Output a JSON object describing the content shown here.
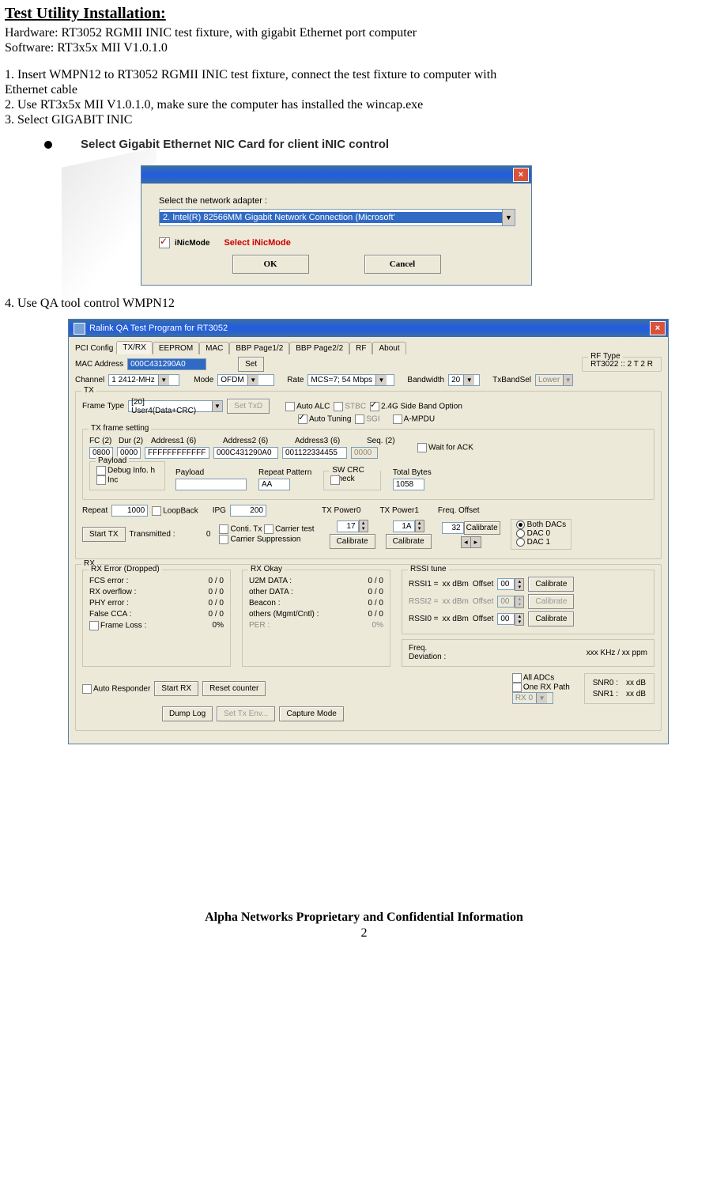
{
  "doc": {
    "title": "Test Utility Installation:",
    "hw": "Hardware: RT3052 RGMII INIC test fixture, with gigabit Ethernet port computer",
    "sw": "Software: RT3x5x MII V1.0.1.0",
    "s1a": "1. Insert WMPN12 to RT3052 RGMII INIC test fixture, connect the test fixture to computer with",
    "s1b": "Ethernet cable",
    "s2": "2. Use RT3x5x MII V1.0.1.0, make sure the computer has installed the  wincap.exe",
    "s3": "3. Select GIGABIT INIC",
    "bullet": "Select Gigabit Ethernet NIC Card for client iNIC control",
    "s4": "4. Use QA tool control WMPN12",
    "footer": "Alpha Networks Proprietary and Confidential Information",
    "page": "2"
  },
  "dlg1": {
    "label": "Select the network adapter :",
    "adapter": "2. Intel(R) 82566MM Gigabit Network Connection (Microsoft'",
    "inic": "iNicMode",
    "inic_hint": "Select iNicMode",
    "ok": "OK",
    "cancel": "Cancel"
  },
  "qa": {
    "title": "Ralink QA Test Program for RT3052",
    "tabs": {
      "pre": "PCI Config",
      "t1": "TX/RX",
      "t2": "EEPROM",
      "t3": "MAC",
      "t4": "BBP Page1/2",
      "t5": "BBP Page2/2",
      "t6": "RF",
      "t7": "About"
    },
    "macaddr_lbl": "MAC Address",
    "macaddr": "000C431290A0",
    "set": "Set",
    "rftype_lbl": "RF Type",
    "rftype": "RT3022 :: 2 T 2 R",
    "channel_lbl": "Channel",
    "channel": "1   2412-MHz",
    "mode_lbl": "Mode",
    "mode": "OFDM",
    "rate_lbl": "Rate",
    "rate": "MCS=7; 54 Mbps",
    "bw_lbl": "Bandwidth",
    "bw": "20",
    "txbandsel_lbl": "TxBandSel",
    "txbandsel": "Lower",
    "tx_legend": "TX",
    "frametype_lbl": "Frame Type",
    "frametype": "[20] User4(Data+CRC)",
    "settxd": "Set TxD",
    "autoalc": "Auto ALC",
    "stbc": "STBC",
    "sideband": "2.4G Side Band Option",
    "autotuning": "Auto Tuning",
    "sgi": "SGI",
    "ampdu": "A-MPDU",
    "txframe_legend": "TX frame setting",
    "fc_lbl": "FC (2)",
    "fc": "0800",
    "dur_lbl": "Dur (2)",
    "dur": "0000",
    "a1_lbl": "Address1 (6)",
    "a1": "FFFFFFFFFFFF",
    "a2_lbl": "Address2 (6)",
    "a2": "000C431290A0",
    "a3_lbl": "Address3 (6)",
    "a3": "001122334455",
    "seq_lbl": "Seq. (2)",
    "seq": "0000",
    "waitack": "Wait for ACK",
    "payload_legend": "Payload",
    "payload_dbg": "Debug Info. h",
    "payload_inc": "Inc",
    "payload_lbl": "Payload",
    "repeatpat_lbl": "Repeat Pattern",
    "repeatpat": "AA",
    "swcrc_legend": "SW CRC Check",
    "swcrc": "SW CRC",
    "totalbytes_lbl": "Total Bytes",
    "totalbytes": "1058",
    "repeat_lbl": "Repeat",
    "repeat": "1000",
    "loopback": "LoopBack",
    "ipg_lbl": "IPG",
    "ipg": "200",
    "starttx": "Start TX",
    "transmitted_lbl": "Transmitted :",
    "transmitted": "0",
    "conti": "Conti. Tx",
    "carrier": "Carrier test",
    "carriersup": "Carrier Suppression",
    "txp0_lbl": "TX Power0",
    "txp0": "17",
    "txp1_lbl": "TX Power1",
    "txp1": "1A",
    "freqoff_lbl": "Freq. Offset",
    "freqoff": "32",
    "calibrate": "Calibrate",
    "dac_both": "Both DACs",
    "dac0": "DAC 0",
    "dac1": "DAC 1",
    "rx_legend": "RX",
    "rxerr_legend": "RX Error (Dropped)",
    "fcserr": "FCS error :",
    "rxovf": "RX overflow :",
    "phyerr": "PHY error :",
    "falsecca": "False CCA :",
    "frameloss": "Frame Loss :",
    "zeroslash": "0 / 0",
    "zeropct": "0%",
    "rxok_legend": "RX Okay",
    "u2m": "U2M DATA :",
    "other": "other DATA :",
    "beacon": "Beacon :",
    "others": "others (Mgmt/Cntl) :",
    "per": "PER :",
    "zeropct_g": "0%",
    "rssi_legend": "RSSI tune",
    "rssi1": "RSSI1 =",
    "rssi2": "RSSI2 =",
    "rssi0": "RSSI0 =",
    "xxdbm": "xx dBm",
    "offset": "Offset",
    "off00": "00",
    "freqdev_lbl": "Freq.\nDeviation :",
    "freqdev_val": "xxx KHz / xx ppm",
    "autoresp": "Auto Responder",
    "startrx": "Start RX",
    "resetcnt": "Reset counter",
    "dumplog": "Dump Log",
    "settxenv": "Set Tx Env...",
    "capture": "Capture Mode",
    "alladcs": "All ADCs",
    "onerx": "One RX Path",
    "rx0": "RX 0",
    "snr0": "SNR0 :",
    "snr1": "SNR1 :",
    "xxdb": "xx dB"
  }
}
